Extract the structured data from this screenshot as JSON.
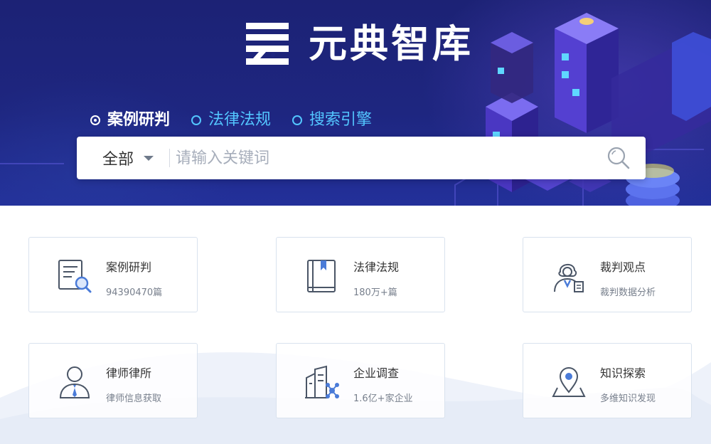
{
  "brand": {
    "name": "元典智库"
  },
  "search_tabs": [
    {
      "label": "案例研判",
      "active": true
    },
    {
      "label": "法律法规",
      "active": false
    },
    {
      "label": "搜索引擎",
      "active": false
    }
  ],
  "search": {
    "scope": "全部",
    "placeholder": "请输入关键词"
  },
  "cards": [
    {
      "title": "案例研判",
      "subtitle": "94390470篇",
      "icon": "case-document-search-icon"
    },
    {
      "title": "法律法规",
      "subtitle": "180万+篇",
      "icon": "law-book-icon"
    },
    {
      "title": "裁判观点",
      "subtitle": "裁判数据分析",
      "icon": "judge-icon"
    },
    {
      "title": "律师律所",
      "subtitle": "律师信息获取",
      "icon": "lawyer-person-icon"
    },
    {
      "title": "企业调查",
      "subtitle": "1.6亿+家企业",
      "icon": "company-building-icon"
    },
    {
      "title": "知识探索",
      "subtitle": "多维知识发现",
      "icon": "knowledge-map-pin-icon"
    }
  ],
  "colors": {
    "hero": "#1e2680",
    "tab_inactive": "#53c6ff",
    "icon_accent": "#4a7bd8"
  }
}
